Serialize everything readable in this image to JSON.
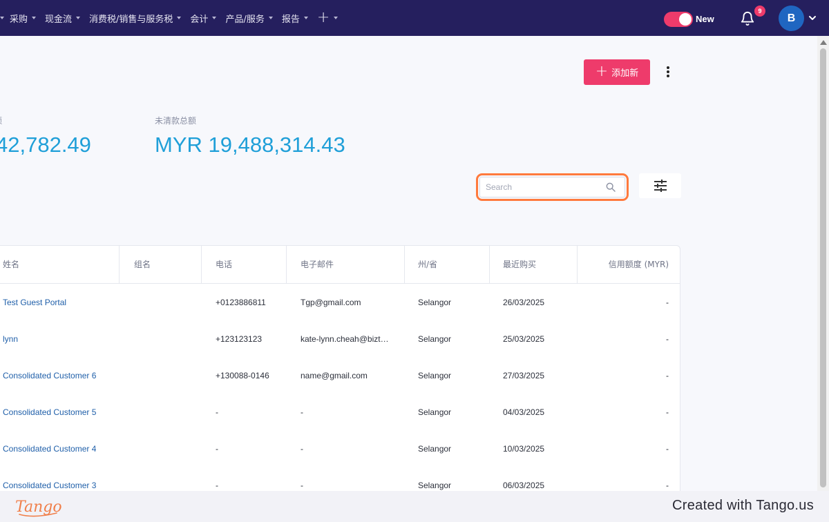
{
  "nav": {
    "items": [
      {
        "label": "采购"
      },
      {
        "label": "现金流"
      },
      {
        "label": "消费税/销售与服务税"
      },
      {
        "label": "会计"
      },
      {
        "label": "产品/服务"
      },
      {
        "label": "报告"
      }
    ],
    "plus": "+",
    "toggle_label": "New",
    "notification_count": "9",
    "avatar_initial": "B"
  },
  "actions": {
    "add_label": "添加新",
    "add_plus": "+"
  },
  "totals": {
    "left_label": "额",
    "left_amount": "42,782.49",
    "right_label": "未清款总额",
    "right_amount": "MYR 19,488,314.43"
  },
  "search": {
    "placeholder": "Search",
    "value": ""
  },
  "table": {
    "headers": [
      "姓名",
      "组名",
      "电话",
      "电子邮件",
      "州/省",
      "最近购买",
      "信用额度 (MYR)"
    ],
    "rows": [
      {
        "name": "Test Guest Portal",
        "group": "",
        "phone": "+0123886811",
        "email": "Tgp@gmail.com",
        "state": "Selangor",
        "last_purchase": "26/03/2025",
        "credit": "-"
      },
      {
        "name": "lynn",
        "group": "",
        "phone": "+123123123",
        "email": "kate-lynn.cheah@bizt…",
        "state": "Selangor",
        "last_purchase": "25/03/2025",
        "credit": "-"
      },
      {
        "name": "Consolidated Customer 6",
        "group": "",
        "phone": "+130088-0146",
        "email": "name@gmail.com",
        "state": "Selangor",
        "last_purchase": "27/03/2025",
        "credit": "-"
      },
      {
        "name": "Consolidated Customer 5",
        "group": "",
        "phone": "-",
        "email": "-",
        "state": "Selangor",
        "last_purchase": "04/03/2025",
        "credit": "-"
      },
      {
        "name": "Consolidated Customer 4",
        "group": "",
        "phone": "-",
        "email": "-",
        "state": "Selangor",
        "last_purchase": "10/03/2025",
        "credit": "-"
      },
      {
        "name": "Consolidated Customer 3",
        "group": "",
        "phone": "-",
        "email": "-",
        "state": "Selangor",
        "last_purchase": "06/03/2025",
        "credit": "-"
      }
    ]
  },
  "footer": {
    "logo_text": "Tango",
    "credit": "Created with Tango.us"
  },
  "colors": {
    "nav_bg": "#251f5e",
    "accent_pink": "#ee3b6b",
    "amount_blue": "#1f9fd8",
    "link_blue": "#1f5fa9",
    "highlight_orange": "#ff7a3d"
  }
}
